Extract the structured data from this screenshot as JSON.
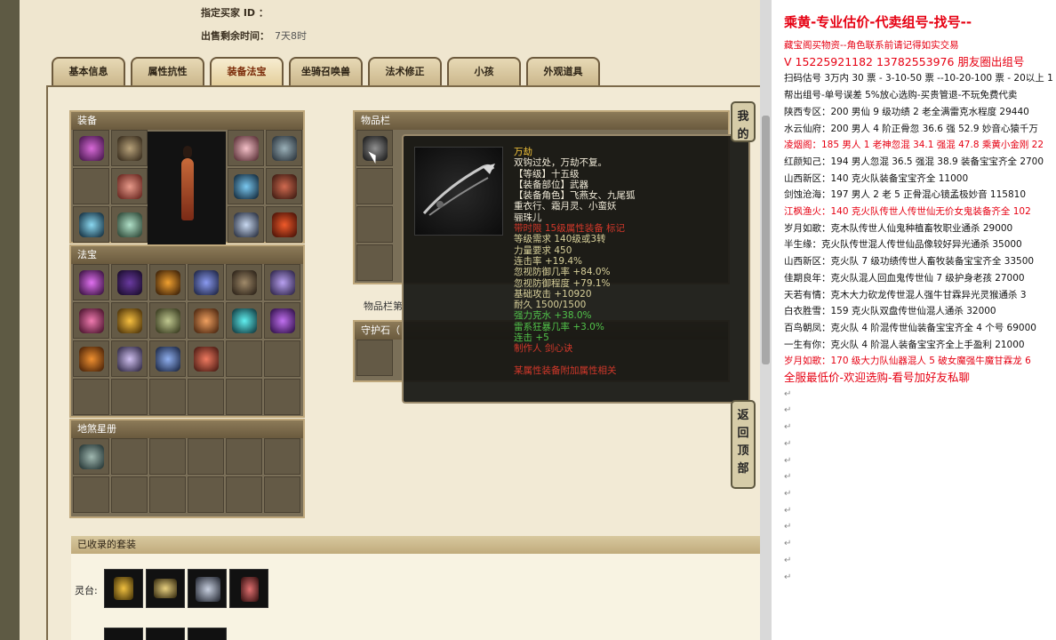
{
  "header": {
    "buyer_label": "指定买家 ID ：",
    "buyer_value": "",
    "time_label": "出售剩余时间：",
    "time_value": "7天8时"
  },
  "tabs": [
    "基本信息",
    "属性抗性",
    "装备法宝",
    "坐骑召唤兽",
    "法术修正",
    "小孩",
    "外观道具"
  ],
  "active_tab": "装备法宝",
  "sections": {
    "equip": "装备",
    "fabao": "法宝",
    "disha": "地煞星册",
    "items": "物品栏",
    "items_row2": "物品栏第",
    "guard": "守护石（",
    "suit": "已收录的套装",
    "lingtai": "灵台:"
  },
  "tooltip": {
    "name": "万劫",
    "desc": "双钩过处，万劫不复。",
    "lines": [
      {
        "t": "【等级】十五级",
        "c": "white"
      },
      {
        "t": "【装备部位】武器",
        "c": "white"
      },
      {
        "t": "【装备角色】飞燕女、九尾狐",
        "c": "white"
      },
      {
        "t": "重衣行、霜月灵、小蛮妖",
        "c": "white"
      },
      {
        "t": "骊珠儿",
        "c": "white"
      },
      {
        "t": "带时限 15级属性装备 标记",
        "c": "red"
      },
      {
        "t": "等级需求 140级或3转",
        "c": "yellowg"
      },
      {
        "t": "力量要求 450",
        "c": "yellowg"
      },
      {
        "t": "连击率 +19.4%",
        "c": "yellowg"
      },
      {
        "t": "忽视防御几率 +84.0%",
        "c": "yellowg"
      },
      {
        "t": "忽视防御程度 +79.1%",
        "c": "yellowg"
      },
      {
        "t": "基础攻击 +10920",
        "c": "yellowg"
      },
      {
        "t": "耐久 1500/1500",
        "c": "yellowg"
      },
      {
        "t": "强力克水 +38.0%",
        "c": "green"
      },
      {
        "t": "雷系狂暴几率 +3.0%",
        "c": "green"
      },
      {
        "t": "连击 +5",
        "c": "green"
      },
      {
        "t": "制作人 剑心诀",
        "c": "red"
      },
      {
        "t": "",
        "c": "white"
      },
      {
        "t": "某属性装备附加属性相关",
        "c": "red"
      }
    ]
  },
  "side_buttons": {
    "top": "我的",
    "bottom": "返回顶部"
  },
  "doc": {
    "title": "乘黄-专业估价-代卖组号-找号--",
    "lines": [
      {
        "t": "藏宝阁买物资--角色联系前请记得如实交易",
        "c": "red",
        "s": "n"
      },
      {
        "t": "V 15225921182    13782553976 朋友圈出组号",
        "c": "red",
        "s": "big"
      },
      {
        "t": "扫码估号 3万内 30 票 - 3-10-50 票  --10-20-100 票 - 20以上 1",
        "c": "k",
        "s": "n"
      },
      {
        "t": "帮出组号-单号误差 5%放心选购-买贵管退-不玩免费代卖",
        "c": "k",
        "s": "n"
      },
      {
        "t": "陕西专区：200 男仙 9 级功绩 2 老全满雷克水程度 29440",
        "c": "k",
        "s": "n"
      },
      {
        "t": "水云仙府：200 男人 4 阶正骨忽 36.6 强 52.9 妙音心猿千万",
        "c": "k",
        "s": "n"
      },
      {
        "t": "凌烟阁：185 男人 1 老神忽混 34.1 强混 47.8 乘黄小金刚 22",
        "c": "red",
        "s": "n"
      },
      {
        "t": "红颜知己：194 男人忽混 36.5 强混 38.9 装备宝宝齐全 2700",
        "c": "k",
        "s": "n"
      },
      {
        "t": "山西新区：140 克火队装备宝宝齐全 11000",
        "c": "k",
        "s": "n"
      },
      {
        "t": "剑蚀沧海：197 男人 2 老 5 正骨混心镜孟极妙音 115810",
        "c": "k",
        "s": "n"
      },
      {
        "t": "江枫渔火：140 克火队传世人传世仙无价女鬼装备齐全 102",
        "c": "red",
        "s": "n"
      },
      {
        "t": "岁月如歌：克木队传世人仙鬼种植畜牧职业通杀 29000",
        "c": "k",
        "s": "n"
      },
      {
        "t": "半生缘：克火队传世混人传世仙品像较好异光通杀 35000",
        "c": "k",
        "s": "n"
      },
      {
        "t": "山西新区：克火队 7 级功绩传世人畜牧装备宝宝齐全 33500",
        "c": "k",
        "s": "n"
      },
      {
        "t": "佳期良年：克火队混人回血鬼传世仙 7 级护身老孩 27000",
        "c": "k",
        "s": "n"
      },
      {
        "t": "天若有情：克木大力砍龙传世混人强牛甘霖异光灵猴通杀 3",
        "c": "k",
        "s": "n"
      },
      {
        "t": "白衣胜雪：159 克火队双盘传世仙混人通杀 32000",
        "c": "k",
        "s": "n"
      },
      {
        "t": "百鸟朝凤：克火队 4 阶混传世仙装备宝宝齐全 4 个号 69000",
        "c": "k",
        "s": "n"
      },
      {
        "t": "一生有你：克火队 4 阶混人装备宝宝齐全上手盈利 21000",
        "c": "k",
        "s": "n"
      },
      {
        "t": "岁月如歌：170 级大力队仙器混人 5 破女魔强牛魔甘霖龙 6",
        "c": "red",
        "s": "n"
      },
      {
        "t": "全服最低价-欢迎选购-看号加好友私聊",
        "c": "red",
        "s": "big"
      }
    ],
    "para_mark": "↵",
    "empty_rows": 12
  },
  "colors": {
    "red": "#e60012",
    "gold": "#f4c43a",
    "green": "#51c34a"
  }
}
